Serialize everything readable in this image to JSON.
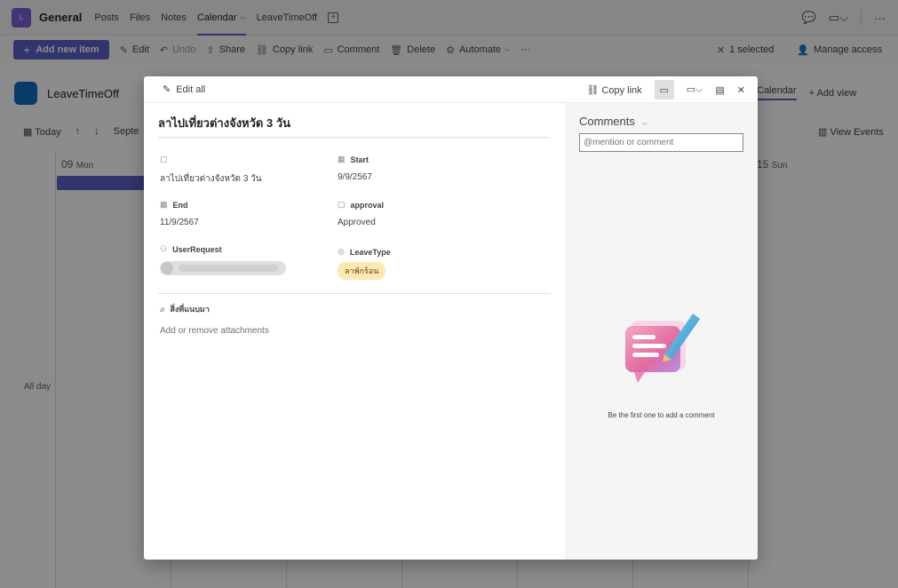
{
  "team": {
    "avatar": "L",
    "name": "General"
  },
  "tabs": [
    {
      "label": "Posts"
    },
    {
      "label": "Files"
    },
    {
      "label": "Notes"
    },
    {
      "label": "Calendar"
    },
    {
      "label": "LeaveTimeOff"
    }
  ],
  "top_icons": [
    "chat-icon",
    "video-icon",
    "more-icon"
  ],
  "toolbar": {
    "add_new_item": "Add new item",
    "edit": "Edit",
    "undo": "Undo",
    "share": "Share",
    "copy_link": "Copy link",
    "comment": "Comment",
    "delete": "Delete",
    "automate": "Automate",
    "more": "···",
    "selected": "1 selected",
    "manage_access": "Manage access"
  },
  "background": {
    "list_title": "LeaveTimeOff",
    "view_name": "Calendar",
    "add_view": "Add view",
    "today": "Today",
    "month": "Septe",
    "view_events": "View Events",
    "day_first": "09",
    "day_first_name": "Mon",
    "day_last": "15",
    "day_last_name": "Sun",
    "all_day": "All day"
  },
  "dialog": {
    "edit_all": "Edit all",
    "copy_link": "Copy link",
    "title": "ลาไปเที่ยวต่างจังหวัด 3 วัน",
    "fields": {
      "title_value": "ลาไปเที่ยวต่างจังหวัด 3 วัน",
      "start_label": "Start",
      "start_value": "9/9/2567",
      "end_label": "End",
      "end_value": "11/9/2567",
      "approval_label": "approval",
      "approval_value": "Approved",
      "user_label": "UserRequest",
      "leavetype_label": "LeaveType",
      "leavetype_value": "ลาพักร้อน",
      "attach_label": "สิ่งที่แนบมา",
      "attach_hint": "Add or remove attachments"
    },
    "comments": {
      "title": "Comments",
      "placeholder": "@mention or comment",
      "empty": "Be the first one to add a comment"
    }
  },
  "colors": {
    "accent": "#5b5fc7",
    "chip_bg": "#fce8b2",
    "list_logo": "#0f6cbd"
  }
}
